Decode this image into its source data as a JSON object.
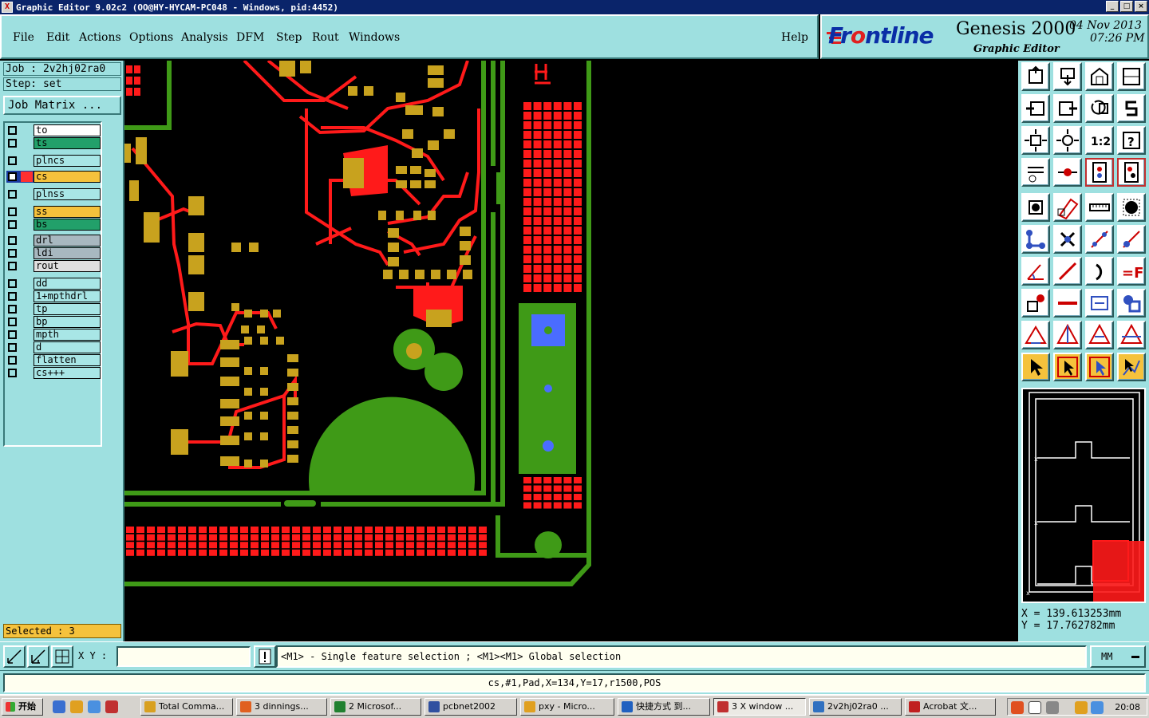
{
  "window": {
    "title": "Graphic Editor 9.02c2  (OO@HY-HYCAM-PC048 - Windows, pid:4452)"
  },
  "menu": [
    "File",
    "Edit",
    "Actions",
    "Options",
    "Analysis",
    "DFM",
    "Step",
    "Rout",
    "Windows"
  ],
  "help": "Help",
  "logo": {
    "brand_pre": "Fr",
    "brand_o": "o",
    "brand_post": "ntline",
    "product": "Genesis 2000",
    "subtitle": "Graphic Editor",
    "date": "04 Nov 2013",
    "time": "07:26 PM"
  },
  "job": {
    "job_label": "Job : 2v2hj02ra0",
    "step_label": "Step: set",
    "matrix_button": "Job Matrix ..."
  },
  "layers": [
    {
      "name": "to",
      "color": "#ffffff"
    },
    {
      "name": "ts",
      "color": "#22a06a"
    },
    {
      "name": "plncs",
      "color": "#a8e6e6"
    },
    {
      "name": "cs",
      "color": "#f5c23c",
      "active": true
    },
    {
      "name": "plnss",
      "color": "#a8e6e6"
    },
    {
      "name": "ss",
      "color": "#f5c23c"
    },
    {
      "name": "bs",
      "color": "#22a06a"
    },
    {
      "name": "drl",
      "color": "#a8b8c0"
    },
    {
      "name": "ldi",
      "color": "#a8b8c0"
    },
    {
      "name": "rout",
      "color": "#e0e0e0"
    },
    {
      "name": "dd",
      "color": "#a8e6e6"
    },
    {
      "name": "1+mpthdrl",
      "color": "#a8e6e6"
    },
    {
      "name": "tp",
      "color": "#a8e6e6"
    },
    {
      "name": "bp",
      "color": "#a8e6e6"
    },
    {
      "name": "mpth",
      "color": "#a8e6e6"
    },
    {
      "name": "d",
      "color": "#a8e6e6"
    },
    {
      "name": "flatten",
      "color": "#a8e6e6"
    },
    {
      "name": "cs+++",
      "color": "#a8e6e6"
    }
  ],
  "selected": "Selected : 3",
  "coords": {
    "x": "X  =  139.613253mm",
    "y": "Y  =  17.762782mm"
  },
  "command": {
    "xy_label": "X Y :",
    "xy_value": "",
    "prompt": "<M1> - Single feature selection ; <M1><M1> Global selection",
    "unit": "MM"
  },
  "status": "cs,#1,Pad,X=134,Y=17,r1500,POS",
  "taskbar": {
    "start": "开始",
    "tasks": [
      {
        "label": "Total Comma...",
        "icon_color": "#d8a020"
      },
      {
        "label": "3 dinnings...",
        "icon_color": "#e06020"
      },
      {
        "label": "2 Microsof...",
        "icon_color": "#208030"
      },
      {
        "label": "pcbnet2002",
        "icon_color": "#3050a0"
      },
      {
        "label": "pxy - Micro...",
        "icon_color": "#e0a020"
      },
      {
        "label": "快捷方式 到...",
        "icon_color": "#2060c0"
      },
      {
        "label": "3 X window ...",
        "icon_color": "#c03030",
        "active": true
      },
      {
        "label": "2v2hj02ra0 ...",
        "icon_color": "#3070c0"
      },
      {
        "label": "Acrobat 文...",
        "icon_color": "#c02020"
      }
    ],
    "clock": "20:08"
  },
  "colors": {
    "panel": "#9ee0e0",
    "copper_red": "#ff1a1a",
    "pad_gold": "#c8a21e",
    "plane_green": "#3f9a17",
    "drill_blue": "#4a6cff",
    "highlight": "#f5c23c"
  },
  "icons": [
    "home-icon",
    "zoom-in-icon",
    "zoom-out-icon",
    "fit-icon",
    "pan-left-icon",
    "pan-right-icon",
    "redraw-icon",
    "snap-icon",
    "center-icon",
    "origin-icon",
    "one-to-one-icon",
    "help-icon",
    "settings-icon",
    "measure-icon",
    "net-icon",
    "net-highlight-icon"
  ]
}
